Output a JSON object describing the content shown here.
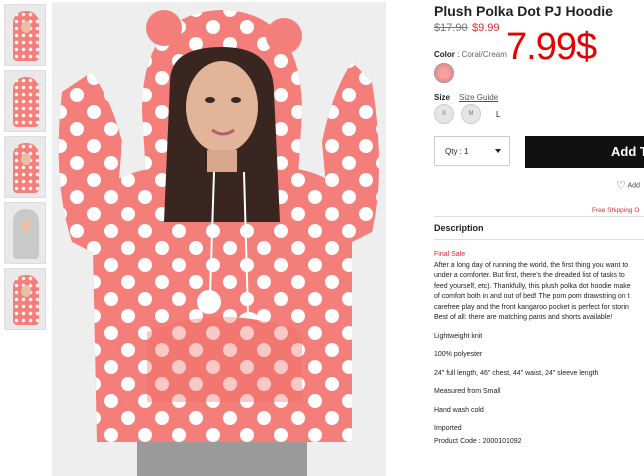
{
  "product": {
    "title": "Plush Polka Dot PJ Hoodie",
    "old_price": "$17.90",
    "new_price": "$9.99",
    "overlay_price": "7.99$",
    "color_label": "Color",
    "color_value": "Coral/Cream",
    "size_label": "Size",
    "size_guide": "Size Guide",
    "sizes": [
      "S",
      "M",
      "L"
    ],
    "qty_label": "Qty : 1",
    "add_button": "Add T",
    "wishlist": "Add",
    "free_shipping": "Free Shipping O",
    "description_heading": "Description",
    "final_sale": "Final Sale",
    "paragraph": [
      "After a long day of running the world, the first thing you want to",
      "under a comforter. But first, there's the dreaded list of tasks to",
      "feed yourself, etc). Thankfully, this plush polka dot hoodie make",
      "of comfort both in and out of bed! The pom pom drawstring on t",
      "carefree play and the front kangaroo pocket is perfect for storin",
      "Best of all: there are matching pants and shorts available!"
    ],
    "details": [
      "Lightweight knit",
      "100% polyester",
      "24\" full length, 46\" chest, 44\" waist, 24\" sleeve length",
      "Measured from Small",
      "Hand wash cold",
      "Imported",
      "Product Code : 2000101092"
    ]
  },
  "colors": {
    "accent_red": "#e4262a",
    "hoodie_coral": "#f47f7a",
    "button_black": "#111111"
  }
}
